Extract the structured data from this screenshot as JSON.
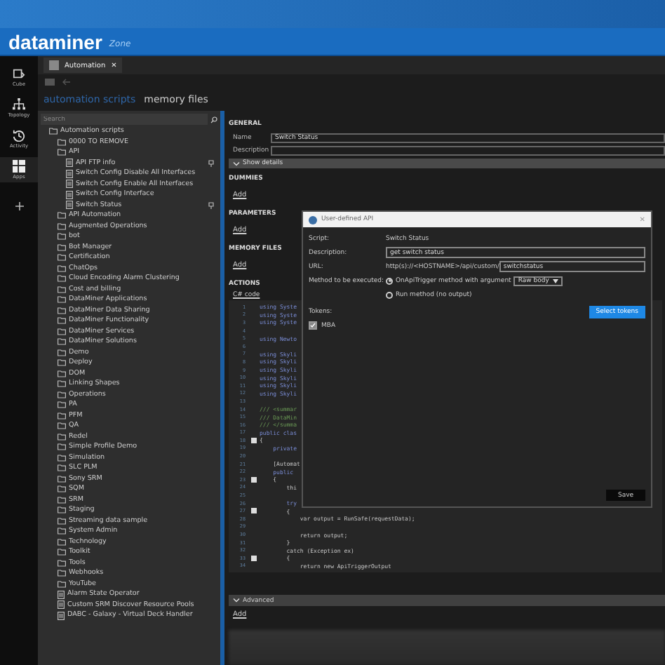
{
  "header": {
    "brand": "dataminer",
    "zone": "Zone"
  },
  "rail": [
    {
      "label": "Cube",
      "selected": false
    },
    {
      "label": "Topology",
      "selected": false
    },
    {
      "label": "Activity",
      "selected": false
    },
    {
      "label": "Apps",
      "selected": true
    }
  ],
  "tab": {
    "label": "Automation",
    "close": "✕"
  },
  "breadcrumb": [
    {
      "label": "automation scripts",
      "selected": false
    },
    {
      "label": "memory files",
      "selected": true
    }
  ],
  "tree": {
    "placeholder": "Search",
    "items": [
      {
        "label": "Automation scripts",
        "kind": "folder",
        "children": [
          {
            "label": "0000 TO REMOVE",
            "kind": "folder"
          },
          {
            "label": "API",
            "kind": "folder",
            "children": [
              {
                "label": "API FTP info",
                "kind": "script",
                "pinned": true
              },
              {
                "label": "Switch Config Disable All Interfaces",
                "kind": "script",
                "pinned": false
              },
              {
                "label": "Switch Config Enable All Interfaces",
                "kind": "script",
                "pinned": false
              },
              {
                "label": "Switch Config Interface",
                "kind": "script",
                "pinned": false
              },
              {
                "label": "Switch Status",
                "kind": "script",
                "pinned": true
              }
            ]
          },
          {
            "label": "API Automation",
            "kind": "folder"
          },
          {
            "label": "Augmented Operations",
            "kind": "folder"
          },
          {
            "label": "bot",
            "kind": "folder"
          },
          {
            "label": "Bot Manager",
            "kind": "folder"
          },
          {
            "label": "Certification",
            "kind": "folder"
          },
          {
            "label": "ChatOps",
            "kind": "folder"
          },
          {
            "label": "Cloud Encoding Alarm Clustering",
            "kind": "folder"
          },
          {
            "label": "Cost and billing",
            "kind": "folder"
          },
          {
            "label": "DataMiner Applications",
            "kind": "folder"
          },
          {
            "label": "DataMiner Data Sharing",
            "kind": "folder"
          },
          {
            "label": "DataMiner Functionality",
            "kind": "folder"
          },
          {
            "label": "DataMiner Services",
            "kind": "folder"
          },
          {
            "label": "DataMiner Solutions",
            "kind": "folder"
          },
          {
            "label": "Demo",
            "kind": "folder"
          },
          {
            "label": "Deploy",
            "kind": "folder"
          },
          {
            "label": "DOM",
            "kind": "folder"
          },
          {
            "label": "Linking Shapes",
            "kind": "folder"
          },
          {
            "label": "Operations",
            "kind": "folder"
          },
          {
            "label": "PA",
            "kind": "folder"
          },
          {
            "label": "PFM",
            "kind": "folder"
          },
          {
            "label": "QA",
            "kind": "folder"
          },
          {
            "label": "Redel",
            "kind": "folder"
          },
          {
            "label": "Simple Profile Demo",
            "kind": "folder"
          },
          {
            "label": "Simulation",
            "kind": "folder"
          },
          {
            "label": "SLC PLM",
            "kind": "folder"
          },
          {
            "label": "Sony SRM",
            "kind": "folder"
          },
          {
            "label": "SQM",
            "kind": "folder"
          },
          {
            "label": "SRM",
            "kind": "folder"
          },
          {
            "label": "Staging",
            "kind": "folder"
          },
          {
            "label": "Streaming data sample",
            "kind": "folder"
          },
          {
            "label": "System Admin",
            "kind": "folder"
          },
          {
            "label": "Technology",
            "kind": "folder"
          },
          {
            "label": "Toolkit",
            "kind": "folder"
          },
          {
            "label": "Tools",
            "kind": "folder"
          },
          {
            "label": "Webhooks",
            "kind": "folder"
          },
          {
            "label": "YouTube",
            "kind": "folder"
          },
          {
            "label": "Alarm State Operator",
            "kind": "script"
          },
          {
            "label": "Custom SRM Discover Resource Pools",
            "kind": "script"
          },
          {
            "label": "DABC - Galaxy - Virtual Deck Handler",
            "kind": "script"
          }
        ]
      }
    ]
  },
  "general": {
    "title": "GENERAL",
    "name_label": "Name",
    "name_value": "Switch Status",
    "description_label": "Description",
    "show_details": "Show details"
  },
  "sections": [
    {
      "title": "DUMMIES",
      "action": "Add"
    },
    {
      "title": "PARAMETERS",
      "action": "Add"
    },
    {
      "title": "MEMORY FILES",
      "action": "Add"
    }
  ],
  "actions": {
    "title": "ACTIONS",
    "tab": "C# code"
  },
  "code": [
    {
      "n": "1",
      "text": "using Syste",
      "kind": "keyword"
    },
    {
      "n": "2",
      "text": "using Syste",
      "kind": "keyword"
    },
    {
      "n": "3",
      "text": "using Syste",
      "kind": "keyword"
    },
    {
      "n": "4"
    },
    {
      "n": "5",
      "text": "using Newto",
      "kind": "keyword"
    },
    {
      "n": "6"
    },
    {
      "n": "7",
      "text": "using Skyli",
      "kind": "keyword"
    },
    {
      "n": "8",
      "text": "using Skyli",
      "kind": "keyword"
    },
    {
      "n": "9",
      "text": "using Skyli",
      "kind": "keyword"
    },
    {
      "n": "10",
      "text": "using Skyli",
      "kind": "keyword"
    },
    {
      "n": "11",
      "text": "using Skyli",
      "kind": "keyword"
    },
    {
      "n": "12",
      "text": "using Skyli",
      "kind": "keyword"
    },
    {
      "n": "13"
    },
    {
      "n": "14",
      "text": "/// <summar",
      "kind": "comment"
    },
    {
      "n": "15",
      "text": "/// DataMin",
      "kind": "comment"
    },
    {
      "n": "16",
      "text": "/// </summa",
      "kind": "comment"
    },
    {
      "n": "17",
      "text": "public clas",
      "kind": "keyword"
    },
    {
      "n": "18",
      "text": "{",
      "kind": "plain",
      "fold": true
    },
    {
      "n": "19",
      "text": "    private",
      "kind": "keyword"
    },
    {
      "n": "20"
    },
    {
      "n": "21",
      "text": "    [Automat",
      "kind": "plain"
    },
    {
      "n": "22",
      "text": "    public",
      "kind": "keyword"
    },
    {
      "n": "23",
      "text": "    {",
      "kind": "plain",
      "fold": true
    },
    {
      "n": "24",
      "text": "        thi",
      "kind": "plain"
    },
    {
      "n": "25"
    },
    {
      "n": "26",
      "text": "        try",
      "kind": "keyword"
    },
    {
      "n": "27",
      "text": "        {",
      "kind": "plain",
      "fold": true
    },
    {
      "n": "28",
      "text": "            var output = RunSafe(requestData);",
      "kind": "plain"
    },
    {
      "n": "29"
    },
    {
      "n": "30",
      "text": "            return output;",
      "kind": "plain"
    },
    {
      "n": "31",
      "text": "        }",
      "kind": "plain"
    },
    {
      "n": "32",
      "text": "        catch (Exception ex)",
      "kind": "plain"
    },
    {
      "n": "33",
      "text": "        {",
      "kind": "plain",
      "fold": true
    },
    {
      "n": "34",
      "text": "            return new ApiTriggerOutput",
      "kind": "plain"
    }
  ],
  "advanced": {
    "label": "Advanced",
    "action": "Add"
  },
  "dialog": {
    "title": "User-defined API",
    "close": "✕",
    "script_label": "Script:",
    "script_value": "Switch Status",
    "description_label": "Description:",
    "description_value": "get switch status",
    "url_label": "URL:",
    "url_prefix": "http(s)://<HOSTNAME>/api/custom/",
    "url_value": "switchstatus",
    "method_label": "Method to be executed:",
    "methods": [
      {
        "label": "OnApiTrigger method with argument",
        "selected": true
      },
      {
        "label": "Run method (no output)",
        "selected": false
      }
    ],
    "argument": "Raw body",
    "tokens_label": "Tokens:",
    "tokens": [
      {
        "label": "MBA",
        "checked": true
      }
    ],
    "select_tokens": "Select tokens",
    "save": "Save"
  }
}
